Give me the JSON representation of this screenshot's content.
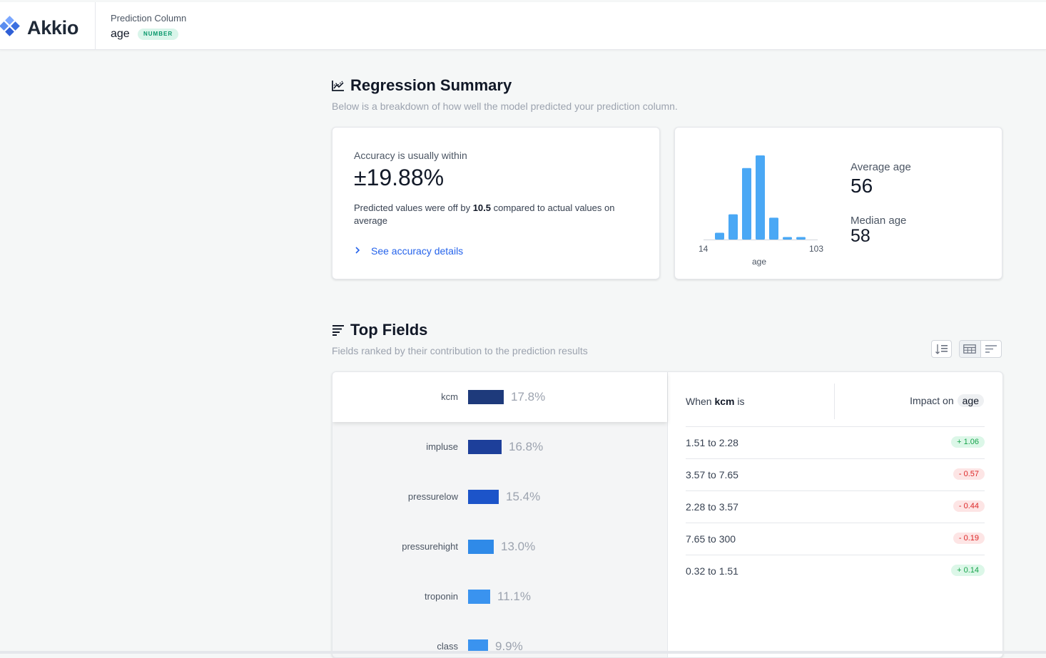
{
  "header": {
    "logo_text": "Akkio",
    "prediction_label": "Prediction Column",
    "prediction_value": "age",
    "type_badge": "NUMBER"
  },
  "regression": {
    "title": "Regression Summary",
    "subtitle": "Below is a breakdown of how well the model predicted your prediction column.",
    "accuracy_label": "Accuracy is usually within",
    "accuracy_value": "±19.88%",
    "desc_prefix": "Predicted values were off by",
    "desc_value": "10.5",
    "desc_suffix": "compared to actual values on average",
    "link_label": "See accuracy details"
  },
  "distribution": {
    "min_label": "14",
    "max_label": "103",
    "axis_label": "age",
    "bars": [
      0.08,
      0.3,
      0.85,
      1.0,
      0.26,
      0.03,
      0.03
    ],
    "bar_color": "#4aa8f5",
    "average_label": "Average age",
    "average_value": "56",
    "median_label": "Median age",
    "median_value": "58"
  },
  "top_fields": {
    "title": "Top Fields",
    "subtitle": "Fields ranked by their contribution to the prediction results",
    "fields": [
      {
        "name": "kcm",
        "pct": "17.8%",
        "value": 17.8,
        "color": "#1e3a7b"
      },
      {
        "name": "impluse",
        "pct": "16.8%",
        "value": 16.8,
        "color": "#1d3f9a"
      },
      {
        "name": "pressurelow",
        "pct": "15.4%",
        "value": 15.4,
        "color": "#1c54c9"
      },
      {
        "name": "pressurehight",
        "pct": "13.0%",
        "value": 13.0,
        "color": "#2f8ae8"
      },
      {
        "name": "troponin",
        "pct": "11.1%",
        "value": 11.1,
        "color": "#3a93ef"
      },
      {
        "name": "class",
        "pct": "9.9%",
        "value": 9.9,
        "color": "#3a93ef"
      }
    ],
    "detail": {
      "when_prefix": "When",
      "when_field": "kcm",
      "when_suffix": "is",
      "impact_label": "Impact on",
      "impact_target": "age",
      "rows": [
        {
          "range": "1.51 to 2.28",
          "impact": "+ 1.06",
          "sign": "pos"
        },
        {
          "range": "3.57 to 7.65",
          "impact": "- 0.57",
          "sign": "neg"
        },
        {
          "range": "2.28 to 3.57",
          "impact": "- 0.44",
          "sign": "neg"
        },
        {
          "range": "7.65 to 300",
          "impact": "- 0.19",
          "sign": "neg"
        },
        {
          "range": "0.32 to 1.51",
          "impact": "+ 0.14",
          "sign": "pos"
        }
      ]
    }
  }
}
